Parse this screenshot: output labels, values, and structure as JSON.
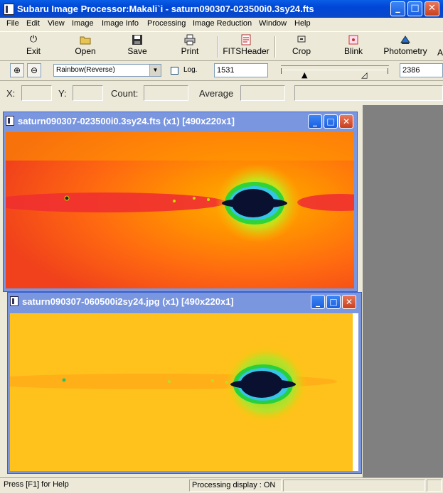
{
  "app": {
    "title": "Subaru Image Processor:Makali`i - saturn090307-023500i0.3sy24.fts",
    "controls": {
      "minimize": "_",
      "maximize": "□",
      "close": "✕"
    }
  },
  "menu": [
    "File",
    "Edit",
    "View",
    "Image",
    "Image Info",
    "Processing",
    "Image Reduction",
    "Window",
    "Help"
  ],
  "toolbar": {
    "buttons": [
      {
        "label": "Exit",
        "icon": "power-icon"
      },
      {
        "label": "Open",
        "icon": "folder-open-icon"
      },
      {
        "label": "Save",
        "icon": "floppy-disk-icon"
      },
      {
        "label": "Print",
        "icon": "printer-icon"
      },
      {
        "label": "FITSHeader",
        "icon": "fits-header-icon"
      },
      {
        "label": "Crop",
        "icon": "crop-icon"
      },
      {
        "label": "Blink",
        "icon": "blink-icon"
      },
      {
        "label": "Photometry",
        "icon": "photometry-icon"
      }
    ],
    "overflow_text": "A"
  },
  "controls": {
    "zoom_in_icon": "zoom-in-icon",
    "zoom_out_icon": "zoom-out-icon",
    "colormap": "Rainbow(Reverse)",
    "log_label": "Log.",
    "log_checked": false,
    "min_value": "1531",
    "max_value": "2386"
  },
  "info": {
    "x_label": "X:",
    "y_label": "Y:",
    "count_label": "Count:",
    "average_label": "Average"
  },
  "windows": [
    {
      "title": "saturn090307-023500i0.3sy24.fts (x1) [490x220x1]",
      "palette": "orange-red"
    },
    {
      "title": "saturn090307-060500i2sy24.jpg (x1) [490x220x1]",
      "palette": "yellow"
    }
  ],
  "status": {
    "help": "Press [F1] for Help",
    "processing": "Processing display : ON"
  }
}
